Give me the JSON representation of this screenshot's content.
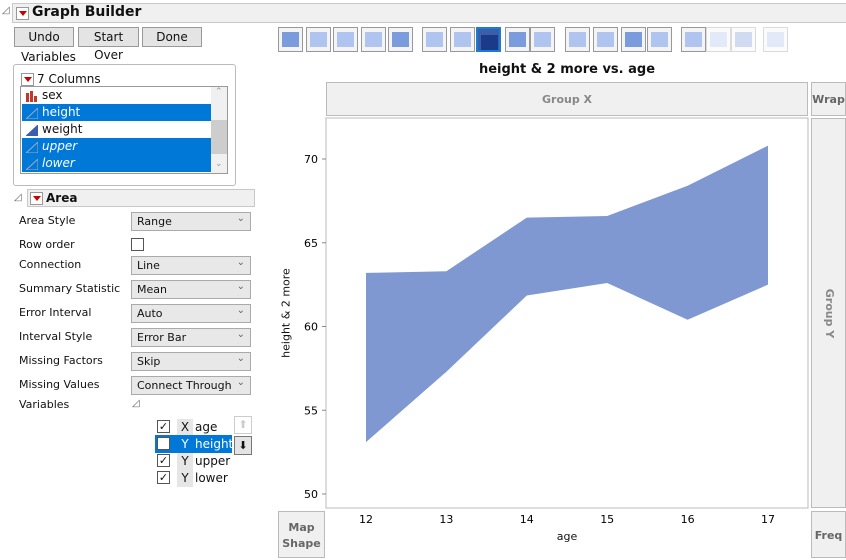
{
  "window": {
    "title": "Graph Builder"
  },
  "buttons": {
    "undo": "Undo",
    "start_over": "Start Over",
    "done": "Done"
  },
  "variables_panel": {
    "legend": "Variables",
    "columns_label": "7 Columns",
    "columns": [
      {
        "name": "sex",
        "type": "nominal",
        "selected": false,
        "italic": false
      },
      {
        "name": "height",
        "type": "continuous",
        "selected": true,
        "italic": false
      },
      {
        "name": "weight",
        "type": "continuous",
        "selected": false,
        "italic": false
      },
      {
        "name": "upper",
        "type": "continuous",
        "selected": true,
        "italic": true
      },
      {
        "name": "lower",
        "type": "continuous",
        "selected": true,
        "italic": true
      }
    ]
  },
  "toolbar": {
    "icons": [
      "points",
      "smoother",
      "line-of-fit",
      "ellipse",
      "contour",
      "line",
      "bar",
      "area",
      "box-plot",
      "histogram",
      "heatmap",
      "pie",
      "treemap",
      "mosaic",
      "caption-box",
      "formula",
      "map-shapes",
      "parallel"
    ],
    "selected": "area"
  },
  "area_panel": {
    "title": "Area",
    "props": [
      {
        "label": "Area Style",
        "value": "Range"
      },
      {
        "label": "Row order",
        "checked": false
      },
      {
        "label": "Connection",
        "value": "Line"
      },
      {
        "label": "Summary Statistic",
        "value": "Mean"
      },
      {
        "label": "Error Interval",
        "value": "Auto"
      },
      {
        "label": "Interval Style",
        "value": "Error Bar"
      },
      {
        "label": "Missing Factors",
        "value": "Skip"
      },
      {
        "label": "Missing Values",
        "value": "Connect Through"
      }
    ],
    "variables_label": "Variables",
    "vars": [
      {
        "role": "X",
        "name": "age",
        "checked": true,
        "selected": false
      },
      {
        "role": "Y",
        "name": "height",
        "checked": false,
        "selected": true
      },
      {
        "role": "Y",
        "name": "upper",
        "checked": true,
        "selected": false
      },
      {
        "role": "Y",
        "name": "lower",
        "checked": true,
        "selected": false
      }
    ]
  },
  "zones": {
    "group_x": "Group X",
    "wrap": "Wrap",
    "group_y": "Group Y",
    "map_shape_1": "Map",
    "map_shape_2": "Shape",
    "freq": "Freq"
  },
  "chart_data": {
    "type": "area",
    "title": "height & 2 more vs. age",
    "xlabel": "age",
    "ylabel": "height & 2 more",
    "x": [
      12,
      13,
      14,
      15,
      16,
      17
    ],
    "upper": [
      63.2,
      63.3,
      66.5,
      66.6,
      68.4,
      70.8
    ],
    "lower": [
      53.1,
      57.3,
      61.85,
      62.6,
      60.4,
      62.5
    ],
    "xticks": [
      "12",
      "13",
      "14",
      "15",
      "16",
      "17"
    ],
    "yticks": [
      "50",
      "55",
      "60",
      "65",
      "70"
    ],
    "ylim": [
      50,
      70
    ],
    "xlim": [
      12,
      17
    ],
    "fill_color": "#7f98d2"
  }
}
